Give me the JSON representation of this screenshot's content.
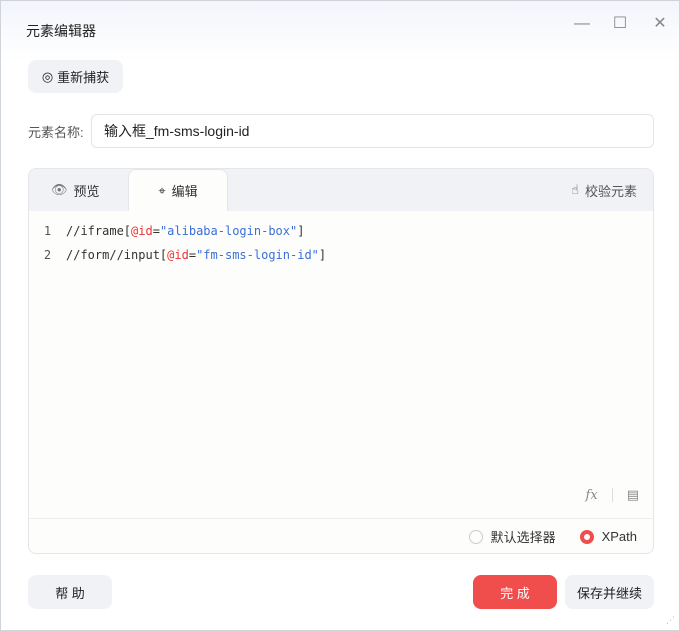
{
  "window": {
    "title": "元素编辑器"
  },
  "recapture_label": "重新捕获",
  "name_field": {
    "label": "元素名称:",
    "value": "输入框_fm-sms-login-id"
  },
  "tabs": [
    {
      "label": "预览"
    },
    {
      "label": "编辑"
    }
  ],
  "validate_label": "校验元素",
  "code": {
    "line1": {
      "n": "1",
      "a": "//iframe[",
      "b": "@id",
      "c": "=",
      "d": "\"alibaba-login-box\"",
      "e": "]"
    },
    "line2": {
      "n": "2",
      "a": "//form//input[",
      "b": "@id",
      "c": "=",
      "d": "\"fm-sms-login-id\"",
      "e": "]"
    }
  },
  "selector_options": [
    {
      "label": "默认选择器",
      "selected": false
    },
    {
      "label": "XPath",
      "selected": true
    }
  ],
  "footer": {
    "help": "帮 助",
    "done": "完 成",
    "save_continue": "保存并继续"
  },
  "colors": {
    "accent": "#f04d4d"
  }
}
